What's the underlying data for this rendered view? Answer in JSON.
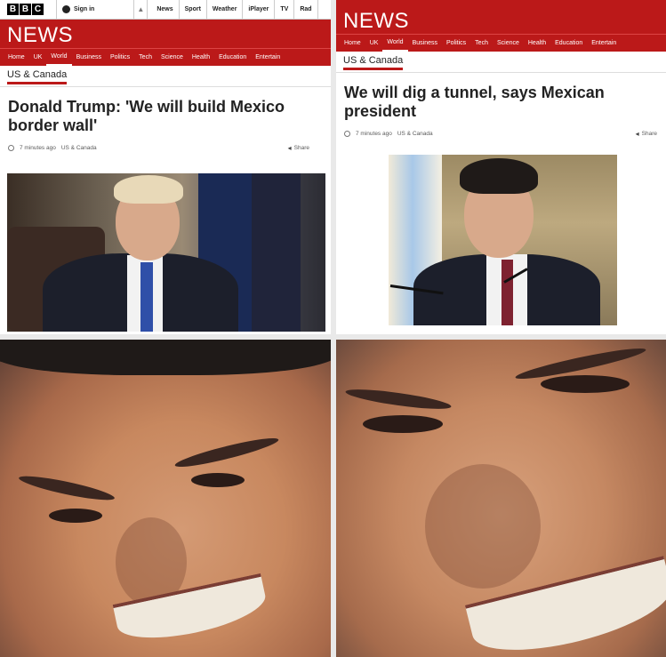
{
  "left_screen": {
    "logo_letters": [
      "B",
      "B",
      "C"
    ],
    "signin": "Sign in",
    "top_links": [
      "News",
      "Sport",
      "Weather",
      "iPlayer",
      "TV",
      "Rad"
    ],
    "news_title": "NEWS",
    "nav": [
      "Home",
      "UK",
      "World",
      "Business",
      "Politics",
      "Tech",
      "Science",
      "Health",
      "Education",
      "Entertain"
    ],
    "subnav": "US & Canada",
    "headline": "Donald Trump: 'We will build Mexico border wall'",
    "time": "7 minutes ago",
    "section": "US & Canada",
    "share": "Share"
  },
  "right_screen": {
    "news_title": "NEWS",
    "nav": [
      "Home",
      "UK",
      "World",
      "Business",
      "Politics",
      "Tech",
      "Science",
      "Health",
      "Education",
      "Entertain"
    ],
    "subnav": "US & Canada",
    "headline": "We will dig a tunnel, says Mexican president",
    "time": "7 minutes ago",
    "section": "US & Canada",
    "share": "Share"
  },
  "colors": {
    "bbc_red": "#bb1919",
    "text": "#222222"
  }
}
